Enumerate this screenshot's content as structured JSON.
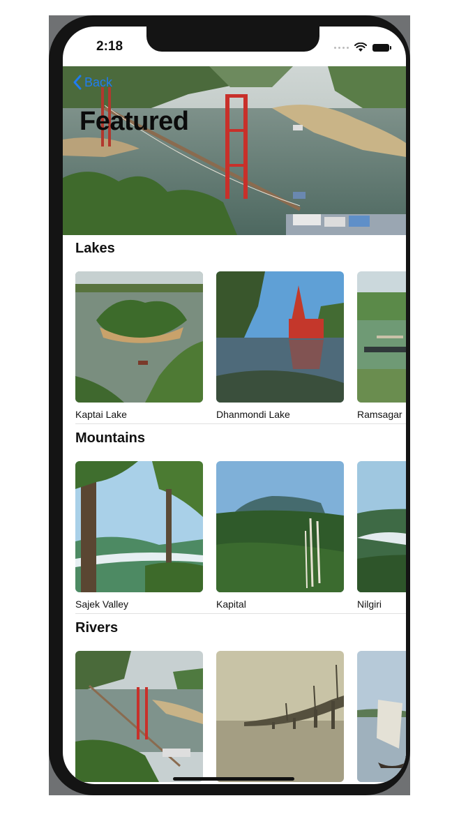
{
  "status_bar": {
    "time": "2:18"
  },
  "nav": {
    "back_label": "Back",
    "title": "Featured"
  },
  "sections": [
    {
      "title": "Lakes",
      "items": [
        {
          "label": "Kaptai Lake"
        },
        {
          "label": "Dhanmondi Lake"
        },
        {
          "label": "Ramsagar"
        }
      ]
    },
    {
      "title": "Mountains",
      "items": [
        {
          "label": "Sajek Valley"
        },
        {
          "label": "Kapital"
        },
        {
          "label": "Nilgiri"
        }
      ]
    },
    {
      "title": "Rivers",
      "items": [
        {
          "label": ""
        },
        {
          "label": ""
        },
        {
          "label": ""
        }
      ]
    }
  ],
  "colors": {
    "accent": "#1f7cf0",
    "phone_frame": "#141414"
  }
}
